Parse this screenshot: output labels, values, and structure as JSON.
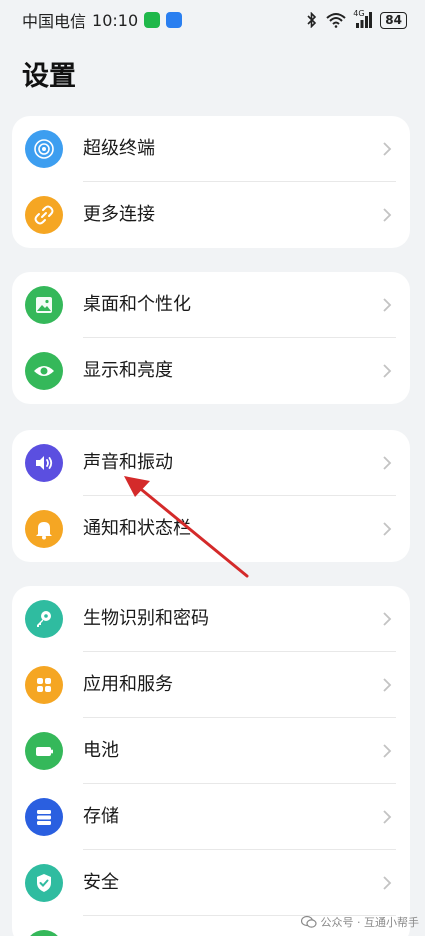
{
  "status_bar": {
    "carrier": "中国电信",
    "time": "10:10",
    "network": "4G",
    "battery": "84"
  },
  "page": {
    "title": "设置"
  },
  "groups": [
    {
      "items": [
        {
          "label": "超级终端",
          "icon": "super-device-icon",
          "color": "#3d9ef0"
        },
        {
          "label": "更多连接",
          "icon": "link-icon",
          "color": "#f5a623"
        }
      ]
    },
    {
      "items": [
        {
          "label": "桌面和个性化",
          "icon": "wallpaper-icon",
          "color": "#35b85a"
        },
        {
          "label": "显示和亮度",
          "icon": "eye-icon",
          "color": "#35b85a"
        }
      ]
    },
    {
      "items": [
        {
          "label": "声音和振动",
          "icon": "speaker-icon",
          "color": "#5b4fe0"
        },
        {
          "label": "通知和状态栏",
          "icon": "bell-icon",
          "color": "#f5a623"
        }
      ]
    },
    {
      "items": [
        {
          "label": "生物识别和密码",
          "icon": "key-icon",
          "color": "#2fbca0"
        },
        {
          "label": "应用和服务",
          "icon": "apps-grid-icon",
          "color": "#f5a623"
        },
        {
          "label": "电池",
          "icon": "battery-icon",
          "color": "#35b85a"
        },
        {
          "label": "存储",
          "icon": "storage-icon",
          "color": "#2a5fe0"
        },
        {
          "label": "安全",
          "icon": "shield-icon",
          "color": "#2fbca0"
        }
      ]
    }
  ],
  "watermark": {
    "text": "公众号 · 互通小帮手"
  },
  "annotation": {
    "arrow_color": "#d42a2a"
  }
}
